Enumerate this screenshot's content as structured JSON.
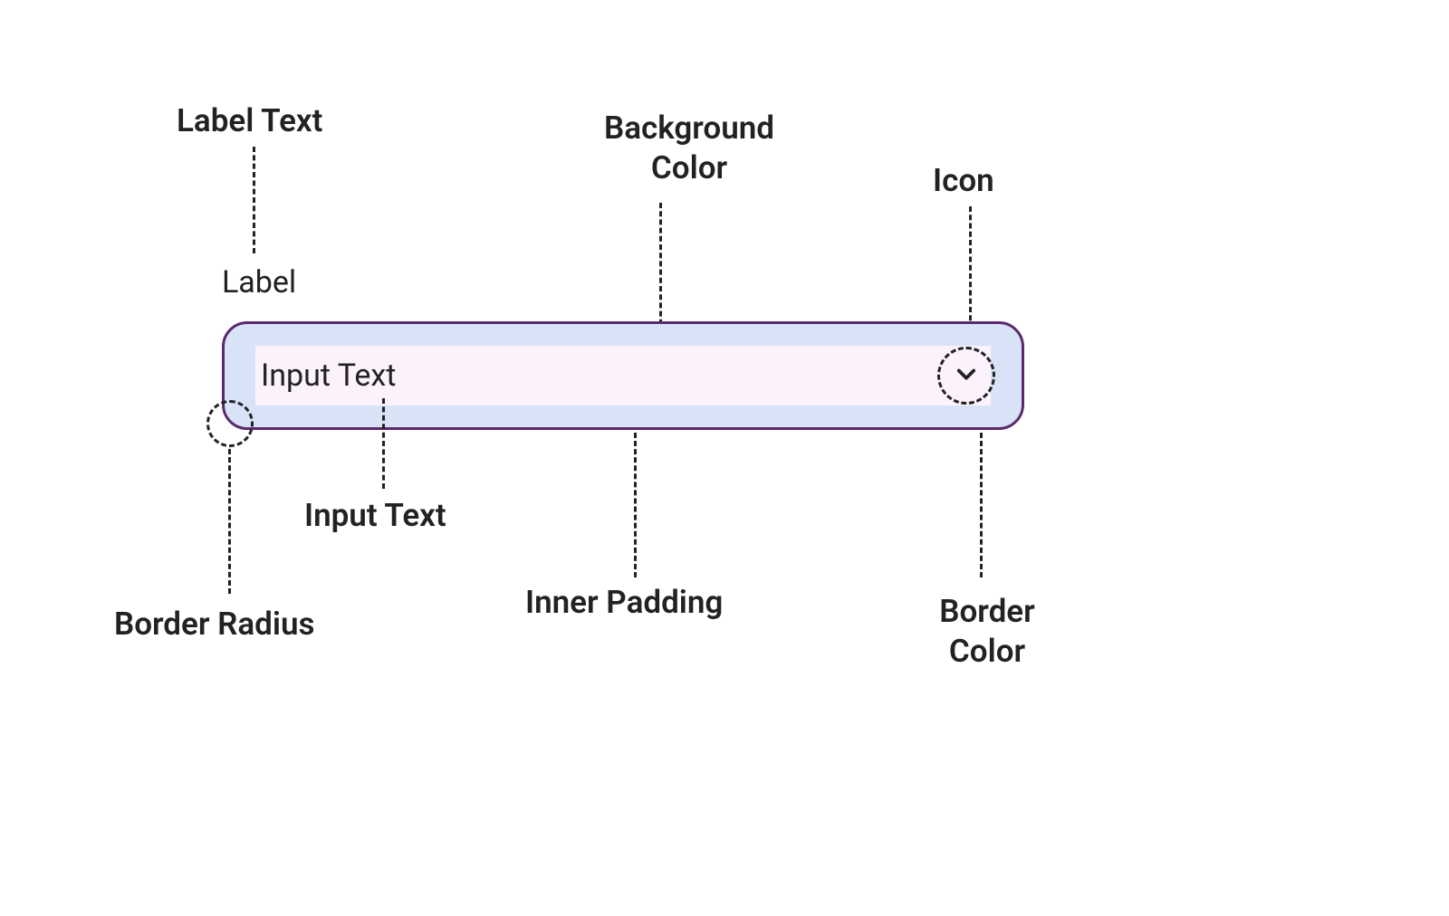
{
  "annotations": {
    "label_text": "Label Text",
    "background_color": "Background\nColor",
    "icon": "Icon",
    "input_text": "Input Text",
    "inner_padding": "Inner Padding",
    "border_radius": "Border Radius",
    "border_color": "Border\nColor"
  },
  "component": {
    "label": "Label",
    "input_value": "Input Text",
    "icon_name": "chevron-down"
  },
  "colors": {
    "border": "#5b2a6b",
    "outer_padding_bg": "#d8e3f8",
    "inner_bg": "#fbf2fb",
    "text": "#222222"
  }
}
